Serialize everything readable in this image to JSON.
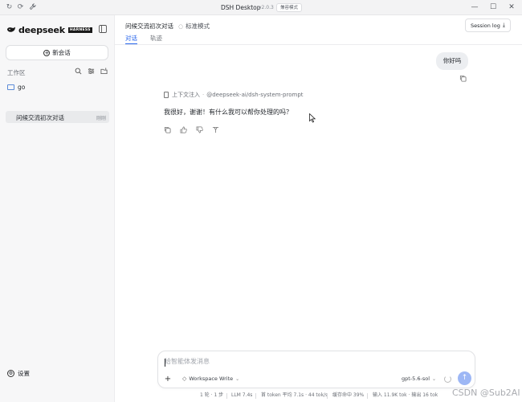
{
  "window": {
    "title": "DSH Desktop",
    "version": "v2.0.3",
    "mode_badge": "兼容模式",
    "icons": [
      "refresh-icon",
      "reload-icon",
      "wrench-icon"
    ],
    "controls": [
      "minimize",
      "maximize",
      "close"
    ]
  },
  "sidebar": {
    "logo_text": "deepseek",
    "logo_badge": "HARNESS",
    "new_chat_label": "新会话",
    "workspace_label": "工作区",
    "folder_name": "go",
    "chats": [
      {
        "title": "问候交流初次对话",
        "time": "刚刚",
        "selected": true
      }
    ],
    "settings_label": "设置"
  },
  "header": {
    "title": "问候交流初次对话",
    "mode_label": "标准模式",
    "tabs": [
      {
        "label": "对话",
        "active": true
      },
      {
        "label": "轨迹",
        "active": false
      }
    ],
    "session_log_label": "Session log"
  },
  "conversation": {
    "user_message": "你好吗",
    "context_label": "上下文注入",
    "context_source": "@deepseek-ai/dsh-system-prompt",
    "assistant_message": "我很好，谢谢！有什么我可以帮你处理的吗？"
  },
  "composer": {
    "placeholder": "给智能体发消息",
    "workspace_mode": "Workspace Write",
    "model": "gpt-5.6-sol"
  },
  "status_bar": {
    "turns": "1 轮 · 1 步",
    "llm": "LLM 7.4s",
    "token_speed": "首 token 平均 7.1s · 44 tok/s",
    "cache": "缓存命中 39%",
    "io": "输入 11.9K tok · 输出 16 tok"
  },
  "watermark": "CSDN @Sub2AI",
  "colors": {
    "accent": "#2563eb",
    "send_button": "#9db7f5",
    "sidebar_bg": "#f7f7f8"
  }
}
